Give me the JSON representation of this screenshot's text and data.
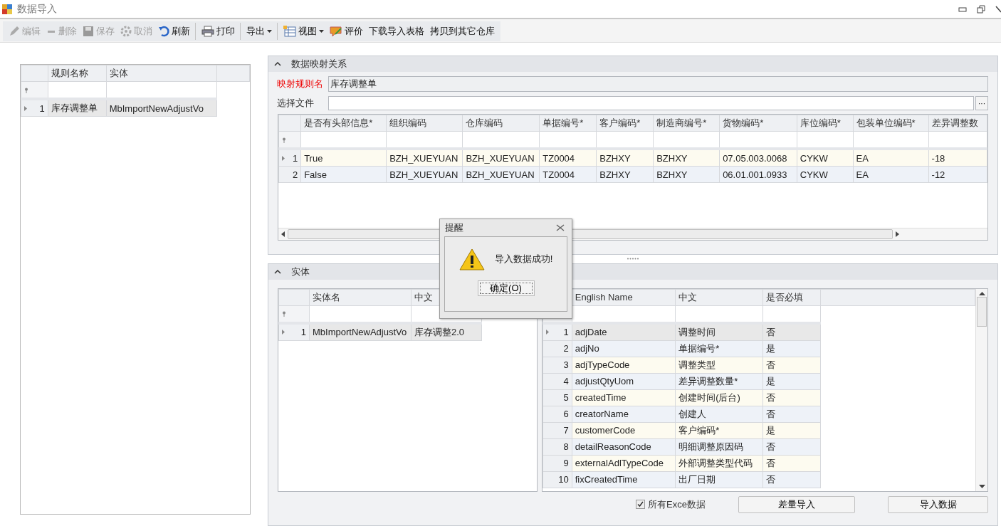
{
  "window": {
    "title": "数据导入"
  },
  "toolbar": [
    {
      "label": "编辑",
      "disabled": true,
      "dropdown": false,
      "separator_after": false
    },
    {
      "label": "删除",
      "disabled": true,
      "dropdown": false,
      "separator_after": false
    },
    {
      "label": "保存",
      "disabled": true,
      "dropdown": false,
      "separator_after": false
    },
    {
      "label": "取消",
      "disabled": true,
      "dropdown": false,
      "separator_after": false
    },
    {
      "label": "刷新",
      "disabled": false,
      "dropdown": false,
      "separator_after": true
    },
    {
      "label": "打印",
      "disabled": false,
      "dropdown": false,
      "separator_after": true
    },
    {
      "label": "导出",
      "disabled": false,
      "dropdown": true,
      "separator_after": true
    },
    {
      "label": "视图",
      "disabled": false,
      "dropdown": true,
      "separator_after": false
    },
    {
      "label": "评价",
      "disabled": false,
      "dropdown": false,
      "separator_after": false
    },
    {
      "label": "下载导入表格",
      "disabled": false,
      "dropdown": false,
      "separator_after": false
    },
    {
      "label": "拷贝到其它仓库",
      "disabled": false,
      "dropdown": false,
      "separator_after": false
    }
  ],
  "rules_grid": {
    "columns": [
      "规则名称",
      "实体"
    ],
    "rows": [
      {
        "number": "1",
        "selected": true,
        "cells": [
          "库存调整单",
          "MbImportNewAdjustVo"
        ]
      }
    ]
  },
  "mapping_panel": {
    "title": "数据映射关系",
    "rule_label": "映射规则名",
    "rule_value": "库存调整单",
    "file_label": "选择文件",
    "browse": "···",
    "columns": [
      "是否有头部信息*",
      "组织编码",
      "仓库编码",
      "单据编号*",
      "客户编码*",
      "制造商编号*",
      "货物编码*",
      "库位编码*",
      "包装单位编码*",
      "差异调整数"
    ],
    "rows": [
      {
        "number": "1",
        "selected": true,
        "cells": [
          "True",
          "BZH_XUEYUAN",
          "BZH_XUEYUAN",
          "TZ0004",
          "BZHXY",
          "BZHXY",
          "07.05.003.0068",
          "CYKW",
          "EA",
          "-18"
        ]
      },
      {
        "number": "2",
        "selected": false,
        "cells": [
          "False",
          "BZH_XUEYUAN",
          "BZH_XUEYUAN",
          "TZ0004",
          "BZHXY",
          "BZHXY",
          "06.01.001.0933",
          "CYKW",
          "EA",
          "-12"
        ]
      }
    ]
  },
  "entity_panel": {
    "title": "实体",
    "entity_grid": {
      "columns": [
        "实体名",
        "中文"
      ],
      "rows": [
        {
          "number": "1",
          "selected": true,
          "cells": [
            "MbImportNewAdjustVo",
            "库存调整2.0"
          ]
        }
      ]
    },
    "field_grid": {
      "columns": [
        "English Name",
        "中文",
        "是否必填"
      ],
      "rows": [
        {
          "number": "1",
          "selected": true,
          "cells": [
            "adjDate",
            "调整时间",
            "否"
          ]
        },
        {
          "number": "2",
          "selected": false,
          "cells": [
            "adjNo",
            "单据编号*",
            "是"
          ]
        },
        {
          "number": "3",
          "selected": false,
          "cells": [
            "adjTypeCode",
            "调整类型",
            "否"
          ]
        },
        {
          "number": "4",
          "selected": false,
          "cells": [
            "adjustQtyUom",
            "差异调整数量*",
            "是"
          ]
        },
        {
          "number": "5",
          "selected": false,
          "cells": [
            "createdTime",
            "创建时间(后台)",
            "否"
          ]
        },
        {
          "number": "6",
          "selected": false,
          "cells": [
            "creatorName",
            "创建人",
            "否"
          ]
        },
        {
          "number": "7",
          "selected": false,
          "cells": [
            "customerCode",
            "客户编码*",
            "是"
          ]
        },
        {
          "number": "8",
          "selected": false,
          "cells": [
            "detailReasonCode",
            "明细调整原因码",
            "否"
          ]
        },
        {
          "number": "9",
          "selected": false,
          "cells": [
            "externalAdlTypeCode",
            "外部调整类型代码",
            "否"
          ]
        },
        {
          "number": "10",
          "selected": false,
          "cells": [
            "fixCreatedTime",
            "出厂日期",
            "否"
          ]
        }
      ]
    },
    "all_excel": {
      "label": "所有Exce数据",
      "checked": true
    },
    "buttons": [
      "差量导入",
      "导入数据"
    ]
  },
  "dialog": {
    "title": "提醒",
    "message": "导入数据成功!",
    "button": "确定(O)"
  }
}
